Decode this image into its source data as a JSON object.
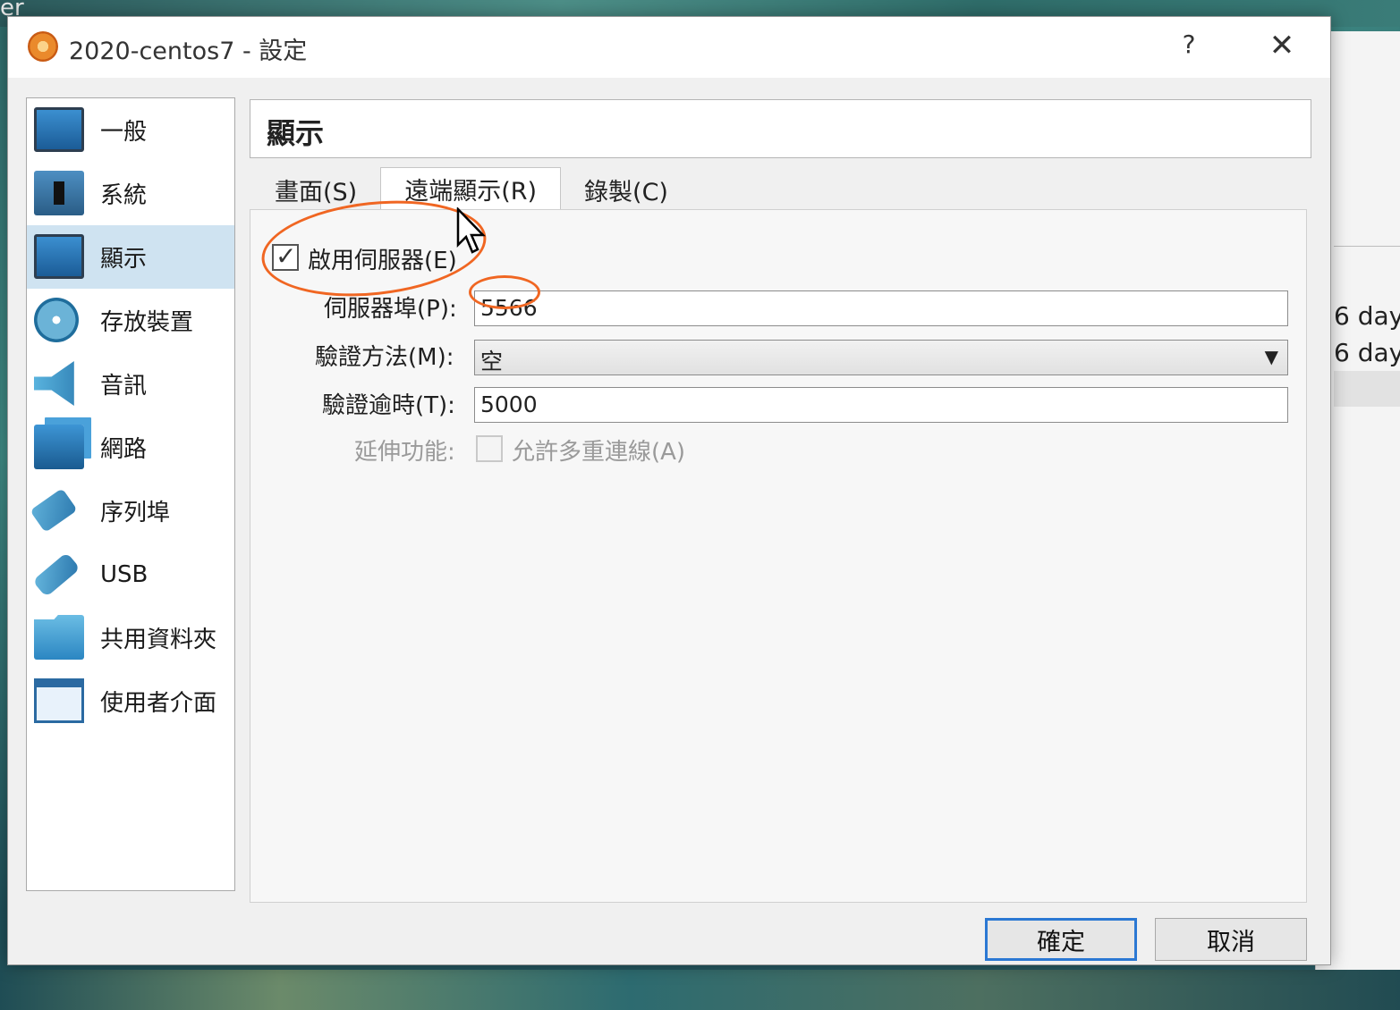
{
  "desktop": {
    "corner_text": "er",
    "bg_rows": [
      "6 day",
      "6 day"
    ]
  },
  "dialog": {
    "title": "2020-centos7 - 設定",
    "help_label": "?",
    "close_label": "✕"
  },
  "sidebar": {
    "items": [
      {
        "label": "一般",
        "icon": "general-monitor-icon"
      },
      {
        "label": "系統",
        "icon": "system-chip-icon"
      },
      {
        "label": "顯示",
        "icon": "display-monitor-icon",
        "selected": true
      },
      {
        "label": "存放裝置",
        "icon": "storage-disk-icon"
      },
      {
        "label": "音訊",
        "icon": "audio-speaker-icon"
      },
      {
        "label": "網路",
        "icon": "network-icon"
      },
      {
        "label": "序列埠",
        "icon": "serial-port-icon"
      },
      {
        "label": "USB",
        "icon": "usb-icon"
      },
      {
        "label": "共用資料夾",
        "icon": "shared-folder-icon"
      },
      {
        "label": "使用者介面",
        "icon": "user-interface-icon"
      }
    ]
  },
  "page": {
    "title": "顯示",
    "tabs": [
      {
        "label": "畫面(S)"
      },
      {
        "label": "遠端顯示(R)",
        "active": true
      },
      {
        "label": "錄製(C)"
      }
    ]
  },
  "remote_display": {
    "enable_server_label": "啟用伺服器(E)",
    "enable_server_checked": true,
    "port_label": "伺服器埠(P):",
    "port_value": "5566",
    "auth_method_label": "驗證方法(M):",
    "auth_method_value": "空",
    "auth_timeout_label": "驗證逾時(T):",
    "auth_timeout_value": "5000",
    "extended_label": "延伸功能:",
    "multi_conn_label": "允許多重連線(A)",
    "multi_conn_checked": false
  },
  "buttons": {
    "ok": "確定",
    "cancel": "取消"
  },
  "colors": {
    "accent": "#2b78d3",
    "selection": "#cfe3f1",
    "annotation": "#f06622"
  }
}
